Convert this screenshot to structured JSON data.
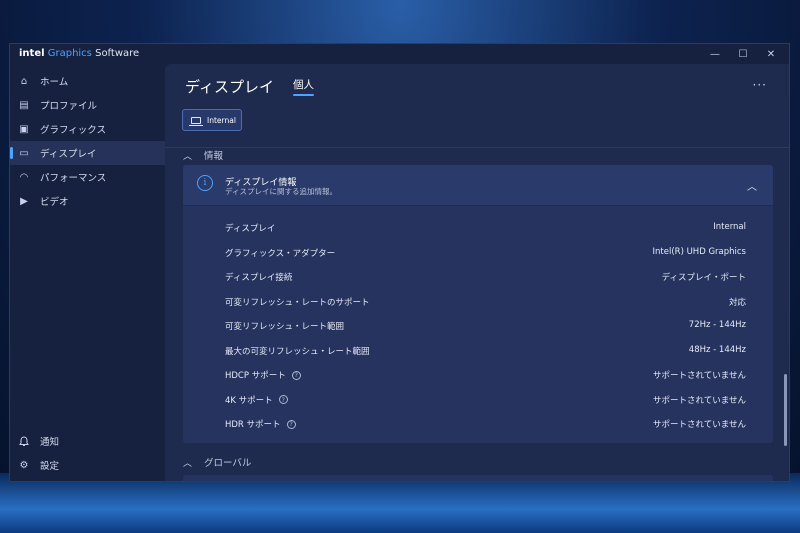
{
  "window": {
    "brand": "intel",
    "app_name_highlight": "Graphics",
    "app_name_rest": "Software",
    "minimize": "—",
    "maximize": "☐",
    "close": "✕"
  },
  "sidebar": {
    "items": [
      {
        "label": "ホーム",
        "icon": "home-icon",
        "glyph": "⌂"
      },
      {
        "label": "プロファイル",
        "icon": "profile-icon",
        "glyph": "▤"
      },
      {
        "label": "グラフィックス",
        "icon": "graphics-icon",
        "glyph": "▣"
      },
      {
        "label": "ディスプレイ",
        "icon": "display-icon",
        "glyph": "▭"
      },
      {
        "label": "パフォーマンス",
        "icon": "performance-icon",
        "glyph": "◠"
      },
      {
        "label": "ビデオ",
        "icon": "video-icon",
        "glyph": "▶"
      }
    ],
    "bottom": [
      {
        "label": "通知",
        "icon": "bell-icon",
        "glyph": "🔔"
      },
      {
        "label": "設定",
        "icon": "gear-icon",
        "glyph": "⚙"
      }
    ]
  },
  "header": {
    "title": "ディスプレイ",
    "tab": "個人",
    "more": "···"
  },
  "display_selector": {
    "label": "Internal"
  },
  "info_section": {
    "label": "情報",
    "card": {
      "title": "ディスプレイ情報",
      "subtitle": "ディスプレイに関する追加情報。",
      "rows": [
        {
          "label": "ディスプレイ",
          "value": "Internal"
        },
        {
          "label": "グラフィックス・アダプター",
          "value": "Intel(R) UHD Graphics"
        },
        {
          "label": "ディスプレイ接続",
          "value": "ディスプレイ・ポート"
        },
        {
          "label": "可変リフレッシュ・レートのサポート",
          "value": "対応"
        },
        {
          "label": "可変リフレッシュ・レート範囲",
          "value": "72Hz - 144Hz"
        },
        {
          "label": "最大の可変リフレッシュ・レート範囲",
          "value": "48Hz - 144Hz"
        },
        {
          "label": "HDCP サポート",
          "value": "サポートされていません"
        },
        {
          "label": "4K サポート",
          "value": "サポートされていません"
        },
        {
          "label": "HDR サポート",
          "value": "サポートされていません"
        }
      ]
    }
  },
  "global_section": {
    "label": "グローバル"
  },
  "colors": {
    "accent": "#4da3ff",
    "window_bg": "#16203f",
    "panel_bg": "#1e2a4e",
    "card_bg": "#25335e"
  }
}
